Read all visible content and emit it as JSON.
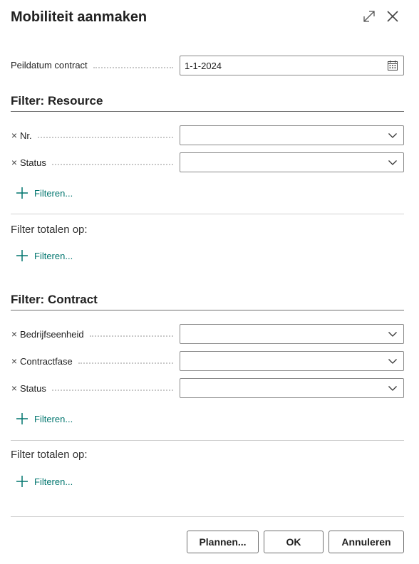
{
  "dialog": {
    "title": "Mobiliteit aanmaken"
  },
  "peildatum": {
    "label": "Peildatum contract",
    "value": "1-1-2024"
  },
  "resource": {
    "title": "Filter: Resource",
    "fields": [
      {
        "label": "Nr.",
        "value": ""
      },
      {
        "label": "Status",
        "value": ""
      }
    ],
    "add_filter": "Filteren...",
    "totals_title": "Filter totalen op:",
    "totals_add_filter": "Filteren..."
  },
  "contract": {
    "title": "Filter: Contract",
    "fields": [
      {
        "label": "Bedrijfseenheid",
        "value": ""
      },
      {
        "label": "Contractfase",
        "value": ""
      },
      {
        "label": "Status",
        "value": ""
      }
    ],
    "add_filter": "Filteren...",
    "totals_title": "Filter totalen op:",
    "totals_add_filter": "Filteren..."
  },
  "buttons": {
    "plan": "Plannen...",
    "ok": "OK",
    "cancel": "Annuleren"
  },
  "colors": {
    "accent": "#00756e",
    "text": "#212121"
  }
}
